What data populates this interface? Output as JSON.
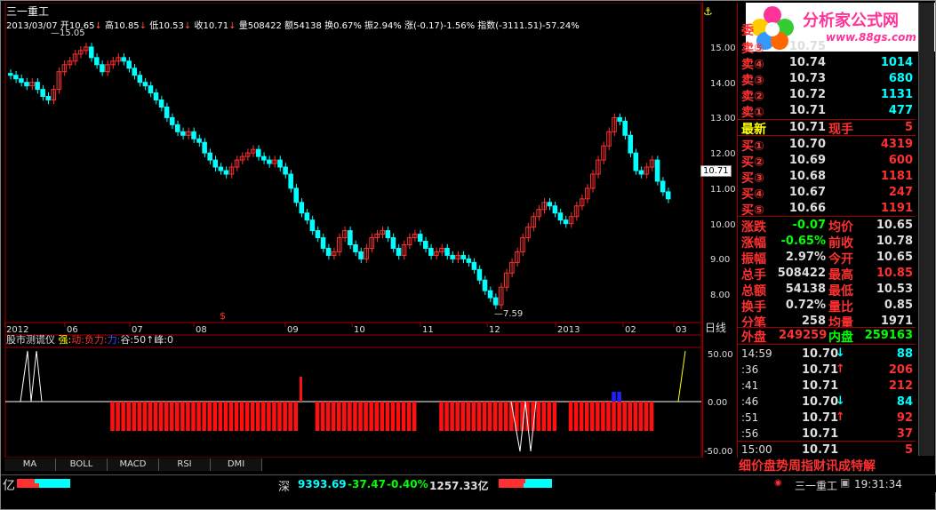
{
  "window": {
    "stock_name": "三一重工"
  },
  "infobar": {
    "date": "2013/03/07",
    "open": "开10.65",
    "high": "高10.85",
    "low": "低10.53",
    "close": "收10.71",
    "volume": "量508422",
    "amount": "额54138",
    "turnover": "换0.67%",
    "amplitude": "振2.94%",
    "change": "涨(-0.17)-1.56%",
    "index": "指数(-3111.51)-57.24%"
  },
  "chart_data": {
    "type": "candlestick",
    "y_ticks": [
      "15.00",
      "14.00",
      "13.00",
      "12.00",
      "11.00",
      "10.00",
      "9.00",
      "8.00"
    ],
    "ylim": [
      7.4,
      15.4
    ],
    "x_labels": [
      "2012",
      "06",
      "07",
      "08",
      "09",
      "10",
      "11",
      "12",
      "2013",
      "02",
      "03"
    ],
    "period": "日线",
    "high_mark": "15.05",
    "low_mark": "7.59",
    "current_price": "10.71",
    "closes": [
      14.2,
      14.1,
      14.0,
      13.9,
      14.0,
      13.8,
      13.6,
      13.5,
      13.8,
      14.3,
      14.5,
      14.6,
      14.8,
      14.9,
      15.0,
      14.7,
      14.5,
      14.3,
      14.5,
      14.6,
      14.7,
      14.6,
      14.4,
      14.2,
      14.0,
      13.9,
      13.7,
      13.5,
      13.3,
      13.0,
      12.8,
      12.6,
      12.5,
      12.6,
      12.4,
      12.3,
      12.0,
      11.8,
      11.6,
      11.5,
      11.4,
      11.6,
      11.8,
      11.9,
      12.0,
      12.1,
      11.9,
      11.8,
      11.7,
      11.8,
      11.6,
      11.4,
      11.0,
      10.6,
      10.3,
      10.1,
      9.8,
      9.6,
      9.3,
      9.1,
      9.2,
      9.6,
      9.8,
      9.4,
      9.2,
      9.0,
      9.3,
      9.6,
      9.7,
      9.8,
      9.6,
      9.3,
      9.1,
      9.4,
      9.6,
      9.7,
      9.5,
      9.3,
      9.1,
      9.2,
      9.3,
      9.1,
      9.0,
      9.1,
      9.0,
      8.9,
      8.7,
      8.4,
      8.1,
      7.9,
      7.7,
      8.2,
      8.6,
      8.9,
      9.2,
      9.6,
      9.9,
      10.2,
      10.4,
      10.6,
      10.5,
      10.3,
      10.1,
      10.0,
      10.2,
      10.5,
      10.7,
      11.0,
      11.4,
      11.8,
      12.2,
      12.6,
      13.0,
      12.9,
      12.5,
      12.0,
      11.5,
      11.4,
      11.6,
      11.8,
      11.2,
      10.9,
      10.7
    ],
    "indicator": {
      "name": "股市测谎仪",
      "legend_strong": "强:",
      "legend_move": "动:",
      "legend_negative": "负力:",
      "legend_force": "力:",
      "legend_valley": "谷:50",
      "legend_arrow": "↑",
      "legend_peak": "峰:0",
      "y_ticks": [
        "50.00",
        "0.00",
        "-50.00"
      ],
      "red_bars": [
        19,
        20,
        21,
        22,
        23,
        24,
        25,
        26,
        27,
        28,
        29,
        30,
        31,
        32,
        33,
        34,
        35,
        36,
        37,
        38,
        39,
        40,
        41,
        42,
        43,
        44,
        45,
        46,
        47,
        48,
        49,
        50,
        51,
        52,
        53,
        57,
        58,
        59,
        60,
        61,
        62,
        63,
        64,
        65,
        66,
        67,
        68,
        69,
        70,
        71,
        72,
        73,
        74,
        75,
        80,
        81,
        82,
        83,
        84,
        85,
        86,
        87,
        88,
        89,
        90,
        91,
        92,
        93,
        94,
        95,
        96,
        97,
        98,
        99,
        100,
        101,
        104,
        105,
        106,
        107,
        108,
        109,
        110,
        111,
        112,
        113,
        114,
        115,
        116,
        117,
        118,
        119
      ],
      "blue_bars": [
        112,
        113
      ]
    }
  },
  "quote": {
    "wei": "委",
    "sells": [
      {
        "label": "卖⑤",
        "price": "10.75",
        "vol": ""
      },
      {
        "label": "卖④",
        "price": "10.74",
        "vol": "1014"
      },
      {
        "label": "卖③",
        "price": "10.73",
        "vol": "680"
      },
      {
        "label": "卖②",
        "price": "10.72",
        "vol": "1131"
      },
      {
        "label": "卖①",
        "price": "10.71",
        "vol": "477"
      }
    ],
    "latest_label": "最新",
    "latest": "10.71",
    "now_hand_label": "现手",
    "now_hand": "5",
    "buys": [
      {
        "label": "买①",
        "price": "10.70",
        "vol": "4319"
      },
      {
        "label": "买②",
        "price": "10.69",
        "vol": "600"
      },
      {
        "label": "买③",
        "price": "10.68",
        "vol": "1181"
      },
      {
        "label": "买④",
        "price": "10.67",
        "vol": "247"
      },
      {
        "label": "买⑤",
        "price": "10.66",
        "vol": "1191"
      }
    ],
    "stats": [
      {
        "l1": "涨跌",
        "v1": "-0.07",
        "l2": "均价",
        "v2": "10.65"
      },
      {
        "l1": "涨幅",
        "v1": "-0.65%",
        "l2": "前收",
        "v2": "10.78"
      },
      {
        "l1": "振幅",
        "v1": "2.97%",
        "l2": "今开",
        "v2": "10.65"
      },
      {
        "l1": "总手",
        "v1": "508422",
        "l2": "最高",
        "v2": "10.85"
      },
      {
        "l1": "总额",
        "v1": "54138",
        "l2": "最低",
        "v2": "10.53"
      },
      {
        "l1": "换手",
        "v1": "0.72%",
        "l2": "量比",
        "v2": "0.85"
      },
      {
        "l1": "分笔",
        "v1": "258",
        "l2": "均量",
        "v2": "1971"
      }
    ],
    "outer_label": "外盘",
    "outer": "249259",
    "inner_label": "内盘",
    "inner": "259163",
    "ticks": [
      {
        "t": "14:59",
        "p": "10.70",
        "a": "↓",
        "v": "88"
      },
      {
        "t": ":36",
        "p": "10.71",
        "a": "↑",
        "v": "206"
      },
      {
        "t": ":41",
        "p": "10.71",
        "a": "",
        "v": "212"
      },
      {
        "t": ":46",
        "p": "10.70",
        "a": "↓",
        "v": "84"
      },
      {
        "t": ":51",
        "p": "10.71",
        "a": "↑",
        "v": "92"
      },
      {
        "t": ":56",
        "p": "10.71",
        "a": "",
        "v": "37"
      },
      {
        "t": "15:00",
        "p": "10.71",
        "a": "",
        "v": "5"
      }
    ],
    "bottom_menu": "细价盘势周指财讯成特解"
  },
  "brand": {
    "title": "分析家公式网",
    "url": "www.88gs.com"
  },
  "tabs": [
    "MA",
    "BOLL",
    "MACD",
    "RSI",
    "DMI"
  ],
  "status": {
    "left": "亿",
    "index_name": "深",
    "index": "9393.69",
    "change": "-37.47",
    "pct": "-0.40%",
    "amount": "1257.33亿",
    "stock": "三一重工",
    "time": "19:31:34"
  }
}
